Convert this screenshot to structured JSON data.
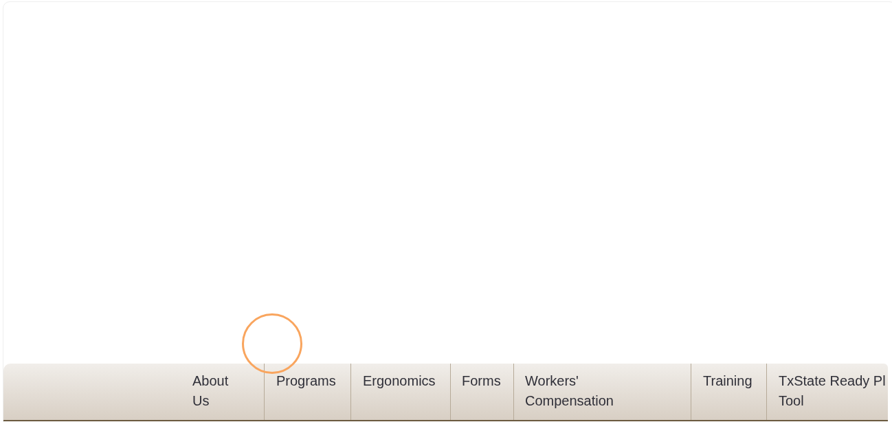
{
  "nav": {
    "items": [
      {
        "lines": [
          "About",
          "Us"
        ]
      },
      {
        "lines": [
          "Programs"
        ]
      },
      {
        "lines": [
          "Ergonomics"
        ]
      },
      {
        "lines": [
          "Forms"
        ]
      },
      {
        "lines": [
          "Workers'",
          "Compensation"
        ]
      },
      {
        "lines": [
          "Training"
        ]
      },
      {
        "lines": [
          "TxState Ready Pl",
          "Tool"
        ]
      }
    ]
  }
}
